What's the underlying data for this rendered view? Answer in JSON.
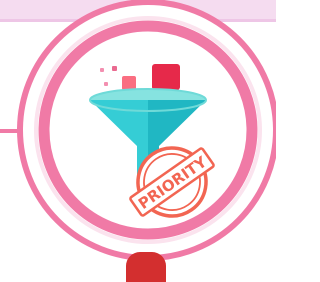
{
  "colors": {
    "strip": "#f5dcf0",
    "ring": "#f07aa6",
    "ring_light": "#fbe3ee",
    "funnel_top": "#86e3e0",
    "funnel_left": "#35cdd5",
    "funnel_right": "#20b7c3",
    "square_light": "#fa6e81",
    "square_dark": "#e6294a",
    "stamp": "#f26552",
    "bottom_mark": "#d32f2f"
  },
  "icon": {
    "name": "funnel-priority-icon",
    "stamp_text": "PRIORITY"
  }
}
